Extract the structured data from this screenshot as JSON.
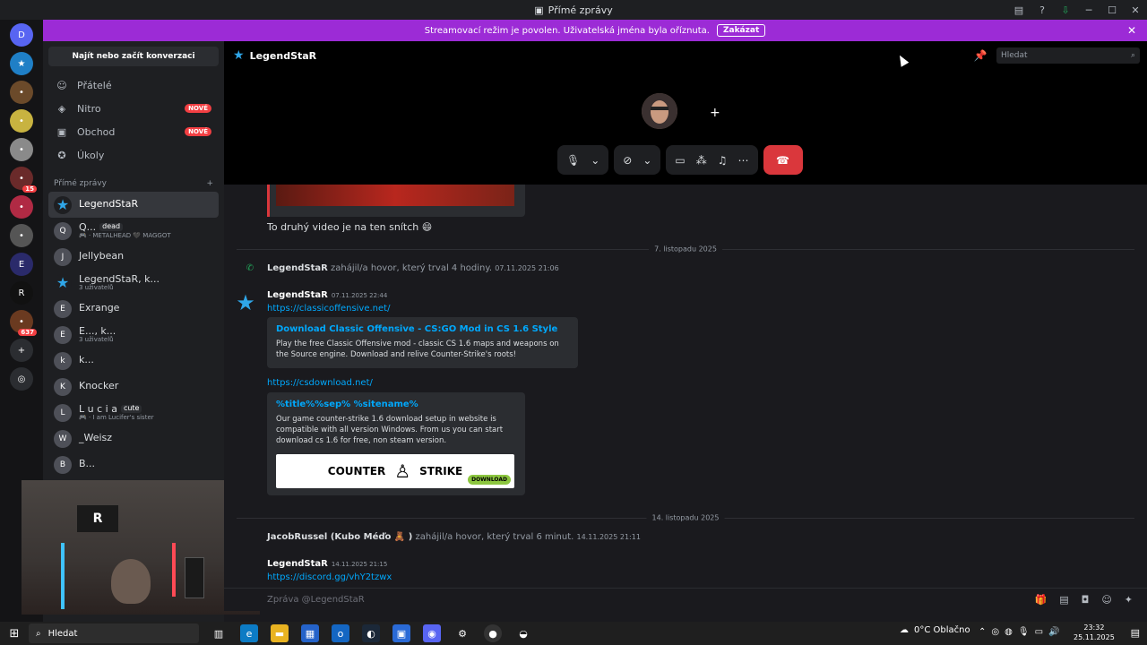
{
  "window": {
    "title": "Přímé zprávy"
  },
  "banner": {
    "text": "Streamovací režim je povolen. Uživatelská jména byla oříznuta.",
    "button": "Zakázat"
  },
  "guilds": [
    {
      "label": "D",
      "color": "#5865f2"
    },
    {
      "label": "★",
      "color": "#1f7fc6"
    },
    {
      "label": "•",
      "color": "#6b4a2a"
    },
    {
      "label": "•",
      "color": "#c8b340"
    },
    {
      "label": "•",
      "color": "#8a8a8a"
    },
    {
      "label": "•",
      "color": "#6a2a2a",
      "badge": "15"
    },
    {
      "label": "•",
      "color": "#b02a44"
    },
    {
      "label": "•",
      "color": "#555555"
    },
    {
      "label": "E",
      "color": "#2a2a6a"
    },
    {
      "label": "R",
      "color": "#111111"
    },
    {
      "label": "•",
      "color": "#6a3a20",
      "badge": "637"
    },
    {
      "label": "+",
      "color": "#2b2d31"
    },
    {
      "label": "◎",
      "color": "#2b2d31"
    }
  ],
  "sidebar": {
    "find_label": "Najít nebo začít konverzaci",
    "nav": [
      {
        "label": "Přátelé",
        "icon": "friends-icon",
        "glyph": "☺"
      },
      {
        "label": "Nitro",
        "icon": "nitro-icon",
        "glyph": "◈",
        "badge": "NOVÉ"
      },
      {
        "label": "Obchod",
        "icon": "shop-icon",
        "glyph": "▣",
        "badge": "NOVÉ"
      },
      {
        "label": "Úkoly",
        "icon": "quests-icon",
        "glyph": "✪"
      }
    ],
    "dm_header": "Přímé zprávy",
    "dms": [
      {
        "name": "LegendStaR",
        "sub": "",
        "avatar": "★",
        "active": true
      },
      {
        "name": "Q...",
        "tag": "dead",
        "sub": "🎮 · METALHEAD 🖤 MAGGOT",
        "avatar": "Q"
      },
      {
        "name": "Jellybean",
        "sub": "",
        "avatar": "J"
      },
      {
        "name": "LegendStaR, k...",
        "sub": "3 uživatelů",
        "avatar": "★"
      },
      {
        "name": "Exrange",
        "sub": "",
        "avatar": "E"
      },
      {
        "name": "E..., k...",
        "sub": "3 uživatelů",
        "avatar": "E"
      },
      {
        "name": "k...",
        "sub": "",
        "avatar": "k"
      },
      {
        "name": "Knocker",
        "sub": "",
        "avatar": "K"
      },
      {
        "name": "L u c i a",
        "tag": "cute",
        "sub": "🎮 · I am Lucifer's sister",
        "avatar": "L"
      },
      {
        "name": "_Weisz",
        "sub": "",
        "avatar": "W"
      },
      {
        "name": "B...",
        "sub": "",
        "avatar": "B"
      }
    ]
  },
  "header": {
    "username": "LegendStaR",
    "search_placeholder": "Hledat"
  },
  "call": {
    "controls": [
      "mic-icon",
      "chevron-down-icon",
      "camera-off-icon",
      "chevron-down-icon",
      "screenshare-icon",
      "activities-icon",
      "soundboard-icon",
      "more-icon"
    ],
    "hangup": "hangup-icon"
  },
  "chat": {
    "message_top": "To druhý video je na ten snítch 😄",
    "divider1": "7. listopadu 2025",
    "call1": {
      "user": "LegendStaR",
      "text": "zahájil/a hovor, který trval 4 hodiny.",
      "time": "07.11.2025 21:06"
    },
    "msg1": {
      "user": "LegendStaR",
      "time": "07.11.2025 22:44",
      "link1": "https://classicoffensive.net/",
      "embed1": {
        "title": "Download Classic Offensive - CS:GO Mod in CS 1.6 Style",
        "desc": "Play the free Classic Offensive mod - classic CS 1.6 maps and weapons on the Source engine. Download and relive Counter-Strike's roots!"
      },
      "link2": "https://csdownload.net/",
      "embed2": {
        "title": "%title%%sep% %sitename%",
        "desc": "Our game counter-strike 1.6 download setup in website is compatible with all version Windows. From us you can start download cs 1.6 for free, non steam version.",
        "image_left": "COUNTER",
        "image_right": "STRIKE",
        "image_badge": "DOWNLOAD"
      }
    },
    "divider2": "14. listopadu 2025",
    "call2": {
      "user": "JacobRussel (Kubo Méďo 🧸 )",
      "text": "zahájil/a hovor, který trval 6 minut.",
      "time": "14.11.2025 21:11"
    },
    "msg2": {
      "user": "LegendStaR",
      "time": "14.11.2025 21:15",
      "link": "https://discord.gg/vhY2tzwx"
    }
  },
  "composer": {
    "placeholder": "Zpráva @LegendStaR"
  },
  "taskbar": {
    "search": "Hledat",
    "weather": "0°C  Oblačno",
    "time": "23:32",
    "date": "25.11.2025"
  }
}
